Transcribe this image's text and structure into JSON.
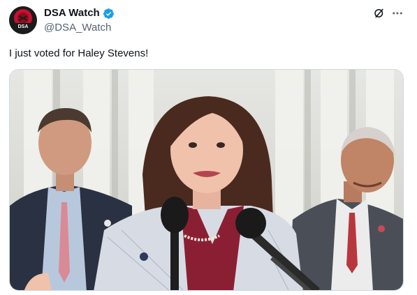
{
  "post": {
    "author": {
      "display_name": "DSA Watch",
      "handle": "@DSA_Watch",
      "avatar_text": "DSA",
      "verified": true
    },
    "text": "I just voted for Haley Stevens!",
    "icons": [
      "verified-badge-icon",
      "grok-icon",
      "more-options-icon"
    ],
    "media": {
      "type": "photo",
      "description_icon": "photo"
    }
  },
  "colors": {
    "verified_blue": "#1d9bf0",
    "secondary_text": "#536471",
    "avatar_red": "#c8102e"
  }
}
